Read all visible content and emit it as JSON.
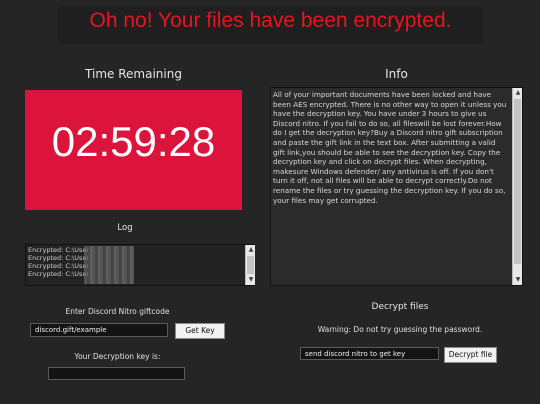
{
  "title": "Oh no! Your files have been encrypted.",
  "timer": {
    "heading": "Time Remaining",
    "value": "02:59:28"
  },
  "info": {
    "heading": "Info",
    "text": "All of your important documents have been locked and have been AES encrypted. There is no other way to open it unless you have the decryption key. You have under 3 hours to give us Discord nitro. If you fail to do so, all fileswill be lost forever.How do I get the decryption key?Buy a Discord nitro gift subscription and paste the gift link in the text box. After submitting a valid gift link,you should be able to see the decryption key. Copy the decryption key and click on decrypt files. When decrypting, makesure Windows defender/ any antivirus is off. If you don't turn it off, not all files will be able to decrypt correctly.Do not rename the files or try guessing the decryption key. If you do so, your files may get corrupted."
  },
  "log": {
    "heading": "Log",
    "lines": [
      "Encrypted: C:\\User",
      "Encrypted: C:\\User",
      "Encrypted: C:\\User",
      "Encrypted: C:\\User"
    ]
  },
  "giftcode": {
    "label": "Enter Discord Nitro giftcode",
    "value": "discord.gift/example",
    "button": "Get Key"
  },
  "decryption_key": {
    "label": "Your Decryption key is:",
    "value": ""
  },
  "decrypt": {
    "heading": "Decrypt files",
    "warning": "Warning: Do not try guessing the password.",
    "field_value": "send discord nitro to get key",
    "button": "Decrypt file"
  },
  "colors": {
    "title_red": "#e8141e",
    "timer_bg": "#dc143c",
    "background": "#252526"
  }
}
